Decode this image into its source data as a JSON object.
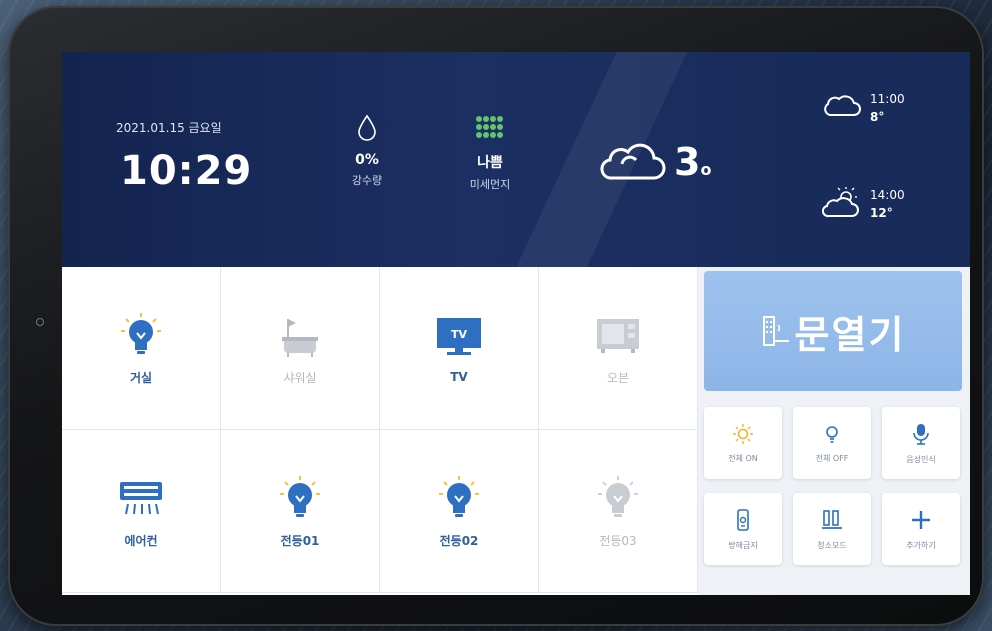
{
  "header": {
    "date": "2021.01.15 금요일",
    "time": "10:29",
    "rain": {
      "value": "0%",
      "label": "강수량",
      "icon": "droplet-icon"
    },
    "dust": {
      "value": "나쁨",
      "label": "미세먼지",
      "icon": "dust-dots-icon"
    },
    "current": {
      "temp": "3",
      "unit": "o",
      "icon": "cloud-icon"
    },
    "forecast": [
      {
        "time": "11:00",
        "temp": "8",
        "unit": "°",
        "icon": "cloud-icon"
      },
      {
        "time": "14:00",
        "temp": "12",
        "unit": "°",
        "icon": "sun-cloud-icon"
      }
    ]
  },
  "devices": [
    {
      "label": "거실",
      "icon": "bulb-icon",
      "state": "on"
    },
    {
      "label": "샤워실",
      "icon": "bathtub-icon",
      "state": "off"
    },
    {
      "label": "TV",
      "icon": "tv-icon",
      "state": "on"
    },
    {
      "label": "오븐",
      "icon": "oven-icon",
      "state": "off"
    },
    {
      "label": "에어컨",
      "icon": "aircon-icon",
      "state": "on"
    },
    {
      "label": "전등01",
      "icon": "bulb-icon",
      "state": "on"
    },
    {
      "label": "전등02",
      "icon": "bulb-icon",
      "state": "on"
    },
    {
      "label": "전등03",
      "icon": "bulb-icon",
      "state": "off"
    }
  ],
  "panel": {
    "door_label": "문열기",
    "buttons": [
      {
        "label": "전체 ON",
        "icon": "sun-bulb-icon"
      },
      {
        "label": "전체 OFF",
        "icon": "bulb-outline-icon"
      },
      {
        "label": "음성인식",
        "icon": "microphone-icon"
      },
      {
        "label": "방해금지",
        "icon": "phone-icon"
      },
      {
        "label": "청소모드",
        "icon": "cleaning-icon"
      },
      {
        "label": "추가하기",
        "icon": "plus-icon"
      }
    ]
  },
  "colors": {
    "accent": "#2f6fc1",
    "header_bg": "#172a58",
    "door_bg": "#8cb5e7",
    "off": "#b4b8c0"
  }
}
